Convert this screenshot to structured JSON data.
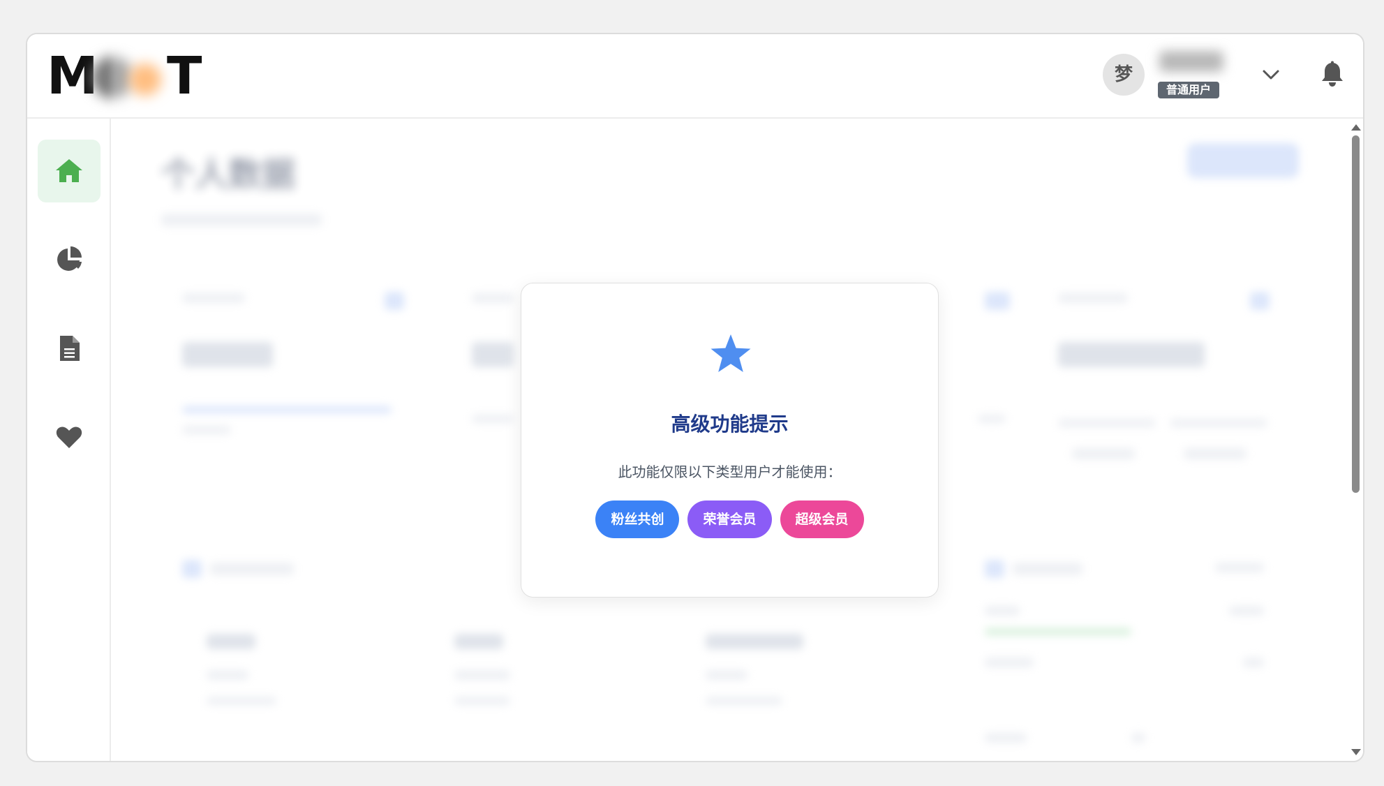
{
  "header": {
    "logo_left": "M",
    "logo_right": "T",
    "avatar_initial": "梦",
    "user_role": "普通用户"
  },
  "sidebar": {
    "items": [
      {
        "id": "home",
        "icon": "home-icon",
        "active": true
      },
      {
        "id": "stats",
        "icon": "pie-chart-icon",
        "active": false
      },
      {
        "id": "documents",
        "icon": "document-icon",
        "active": false
      },
      {
        "id": "favorites",
        "icon": "heart-icon",
        "active": false
      }
    ]
  },
  "background": {
    "title": "个人数据"
  },
  "modal": {
    "icon": "star-icon",
    "title": "高级功能提示",
    "description": "此功能仅限以下类型用户才能使用：",
    "tiers": [
      {
        "label": "粉丝共创",
        "color": "#3b82f6"
      },
      {
        "label": "荣誉会员",
        "color": "#8b5cf6"
      },
      {
        "label": "超级会员",
        "color": "#ec4899"
      }
    ]
  },
  "colors": {
    "accent_green": "#4caf50",
    "icon_gray": "#555555",
    "star_blue": "#4f8ef0",
    "title_navy": "#1f3a8a"
  }
}
